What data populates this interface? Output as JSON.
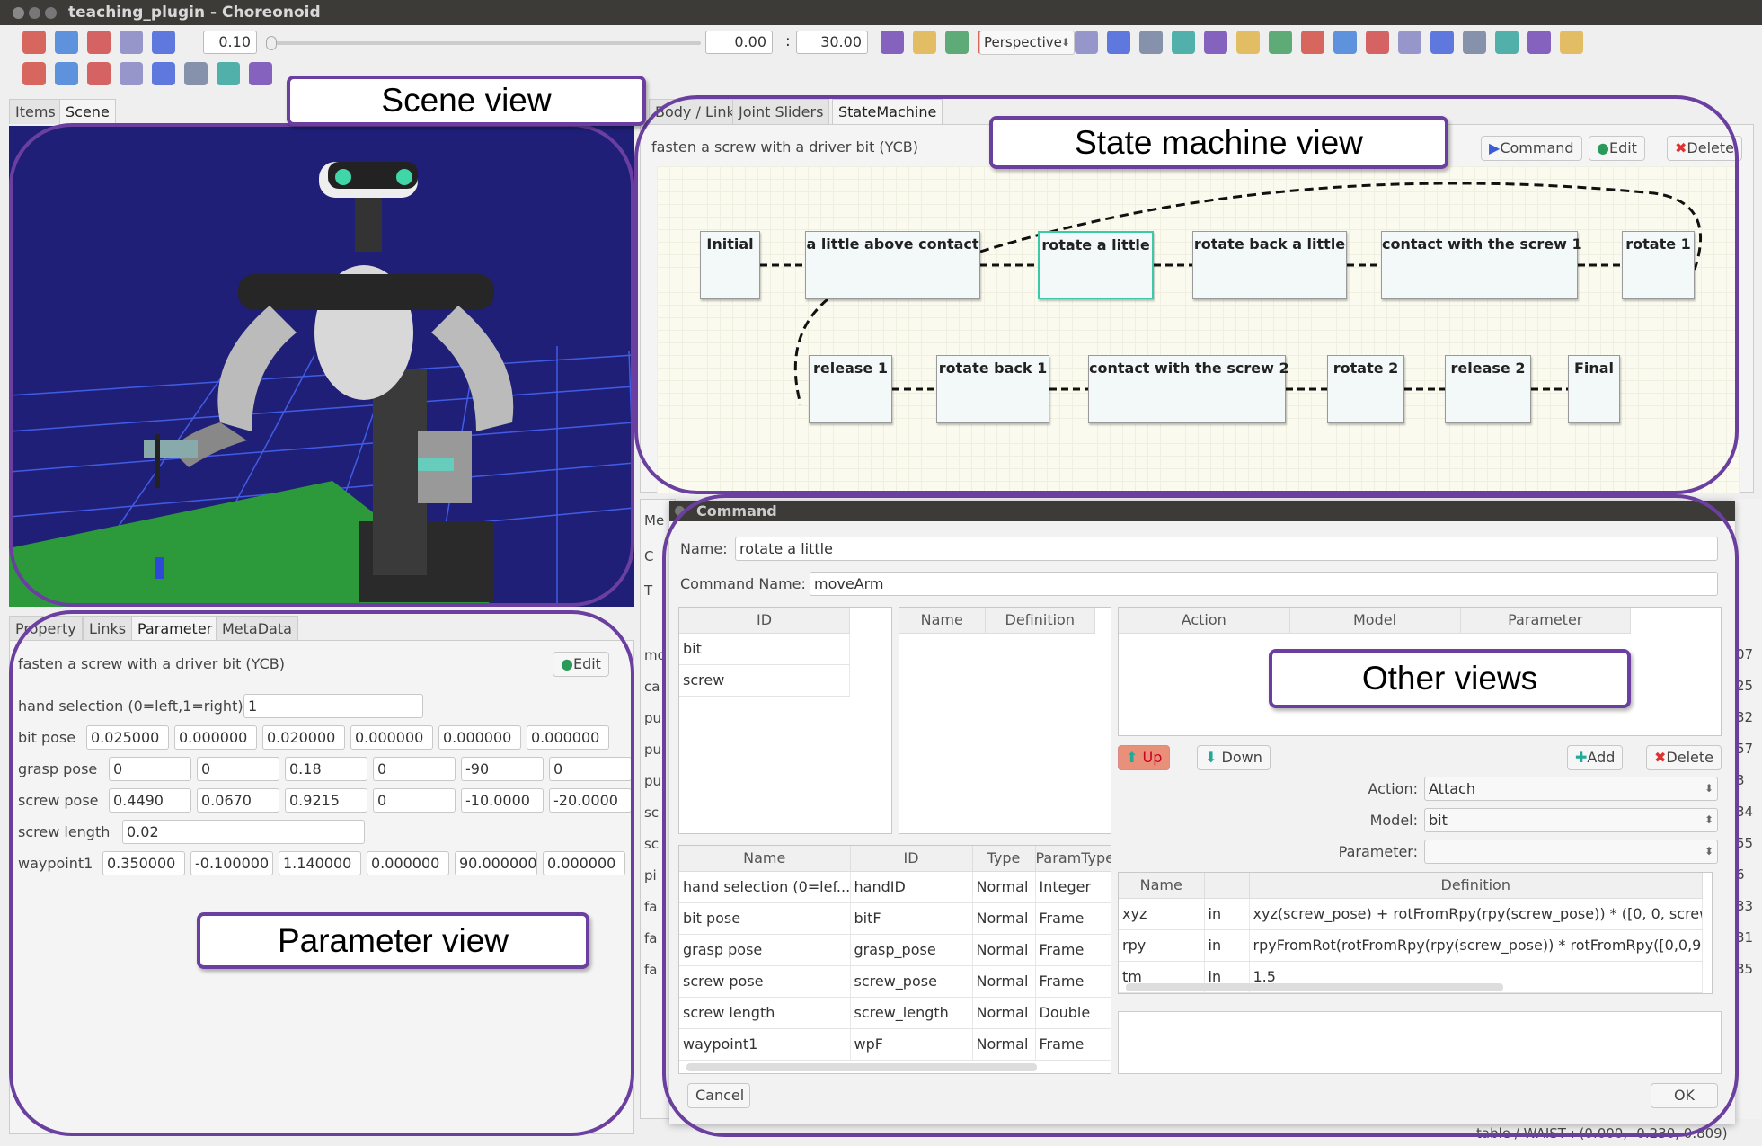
{
  "window": {
    "title": "teaching_plugin - Choreonoid"
  },
  "toolbar": {
    "time_step": "0.10",
    "time_start": "0.00",
    "time_end": "30.00",
    "separator": ":",
    "camera_mode": "Perspective",
    "icons_row1": [
      "body-icon",
      "script-icon",
      "play-from-start-icon",
      "play-icon",
      "refresh-icon"
    ],
    "icons_row1b": [
      "wrench-icon",
      "collision-icon",
      "move-icon",
      "camera-icon",
      "scene-icon",
      "settings-icon",
      "wave-icon",
      "wave2-icon",
      "wrench2-icon",
      "sphere-red-icon",
      "sphere-red2-icon",
      "forward-icon",
      "arrow-right-icon",
      "columns-icon",
      "panel-icon",
      "redo-icon",
      "frame-icon",
      "joints-icon",
      "globe-icon",
      "grid-icon",
      "window-icon",
      "wrench3-icon"
    ],
    "icons_row2": [
      "pose1-icon",
      "pose2-icon",
      "pose3-icon",
      "pose4-icon",
      "pose5-icon",
      "pose6-icon",
      "pose7-icon",
      "pose8-icon"
    ]
  },
  "left_tabs": [
    "Items",
    "Scene"
  ],
  "scene": {
    "colors": {
      "background": "#1f1f78",
      "floor": "#2c9a3a",
      "grid": "#4a6cff"
    }
  },
  "right_tabs": [
    "Body / Link",
    "Joint Sliders",
    "StateMachine"
  ],
  "state_machine": {
    "task": "fasten a screw with a driver bit (YCB)",
    "command_label": "Command",
    "edit_label": "Edit",
    "delete_label": "Delete",
    "row1": [
      "Initial",
      "a little above contact",
      "rotate a little",
      "rotate back a little",
      "contact with the screw 1",
      "rotate 1"
    ],
    "row2": [
      "release 1",
      "rotate back 1",
      "contact with the screw 2",
      "rotate 2",
      "release 2",
      "Final"
    ],
    "selected": "rotate a little"
  },
  "param_tabs": [
    "Property",
    "Links",
    "Parameter",
    "MetaData"
  ],
  "parameters": {
    "task": "fasten a screw with a driver bit (YCB)",
    "edit_label": "Edit",
    "rows": [
      {
        "label": "hand selection (0=left,1=right)",
        "values": [
          "1"
        ]
      },
      {
        "label": "bit pose",
        "values": [
          "0.025000",
          "0.000000",
          "0.020000",
          "0.000000",
          "0.000000",
          "0.000000"
        ]
      },
      {
        "label": "grasp pose",
        "values": [
          "0",
          "0",
          "0.18",
          "0",
          "-90",
          "0"
        ]
      },
      {
        "label": "screw pose",
        "values": [
          "0.4490",
          "0.0670",
          "0.9215",
          "0",
          "-10.0000",
          "-20.0000"
        ]
      },
      {
        "label": "screw length",
        "values": [
          "0.02"
        ]
      },
      {
        "label": "waypoint1",
        "values": [
          "0.350000",
          "-0.100000",
          "1.140000",
          "0.000000",
          "90.000000",
          "0.000000"
        ]
      }
    ]
  },
  "side_stub": {
    "labels": [
      "Me",
      "C",
      "T",
      "mo",
      "ca",
      "pu",
      "pu",
      "pu",
      "sc",
      "sc",
      "pi",
      "fa",
      "fa",
      "fa"
    ],
    "right_nums": [
      "07",
      "25",
      "32",
      "57",
      "3",
      "34",
      "55",
      "6",
      "33",
      "31",
      "35"
    ]
  },
  "command_dialog": {
    "title": "Command",
    "name_label": "Name:",
    "name_value": "rotate a little",
    "command_name_label": "Command Name:",
    "command_name_value": "moveArm",
    "id_table": {
      "header": "ID",
      "rows": [
        "bit",
        "screw"
      ]
    },
    "name_def_table": {
      "headers": [
        "Name",
        "Definition"
      ]
    },
    "action_table": {
      "headers": [
        "Action",
        "Model",
        "Parameter"
      ]
    },
    "up_label": "Up",
    "down_label": "Down",
    "add_label": "Add",
    "delete_label": "Delete",
    "action_label": "Action:",
    "action_value": "Attach",
    "model_label": "Model:",
    "model_value": "bit",
    "parameter_label": "Parameter:",
    "parameter_value": "",
    "param_table": {
      "headers": [
        "Name",
        "ID",
        "Type",
        "ParamType"
      ],
      "rows": [
        [
          "hand selection (0=lef...",
          "handID",
          "Normal",
          "Integer"
        ],
        [
          "bit pose",
          "bitF",
          "Normal",
          "Frame"
        ],
        [
          "grasp pose",
          "grasp_pose",
          "Normal",
          "Frame"
        ],
        [
          "screw pose",
          "screw_pose",
          "Normal",
          "Frame"
        ],
        [
          "screw length",
          "screw_length",
          "Normal",
          "Double"
        ],
        [
          "waypoint1",
          "wpF",
          "Normal",
          "Frame"
        ]
      ]
    },
    "def_table": {
      "headers": [
        "Name",
        "",
        "Definition"
      ],
      "rows": [
        [
          "xyz",
          "in",
          "xyz(screw_pose) + rotFromRpy(rpy(screw_pose)) * ([0, 0, screw_l..."
        ],
        [
          "rpy",
          "in",
          "rpyFromRot(rotFromRpy(rpy(screw_pose)) * rotFromRpy([0,0,90]))"
        ],
        [
          "tm",
          "in",
          "1.5"
        ]
      ]
    },
    "cancel_label": "Cancel",
    "ok_label": "OK"
  },
  "status_bar": {
    "text": "table / WAIST : (0.000, -0.230, 0.809)"
  },
  "callouts": {
    "scene": "Scene view",
    "state_machine": "State machine view",
    "other": "Other views",
    "parameter": "Parameter view"
  },
  "accent_color": "#6b3fa0"
}
